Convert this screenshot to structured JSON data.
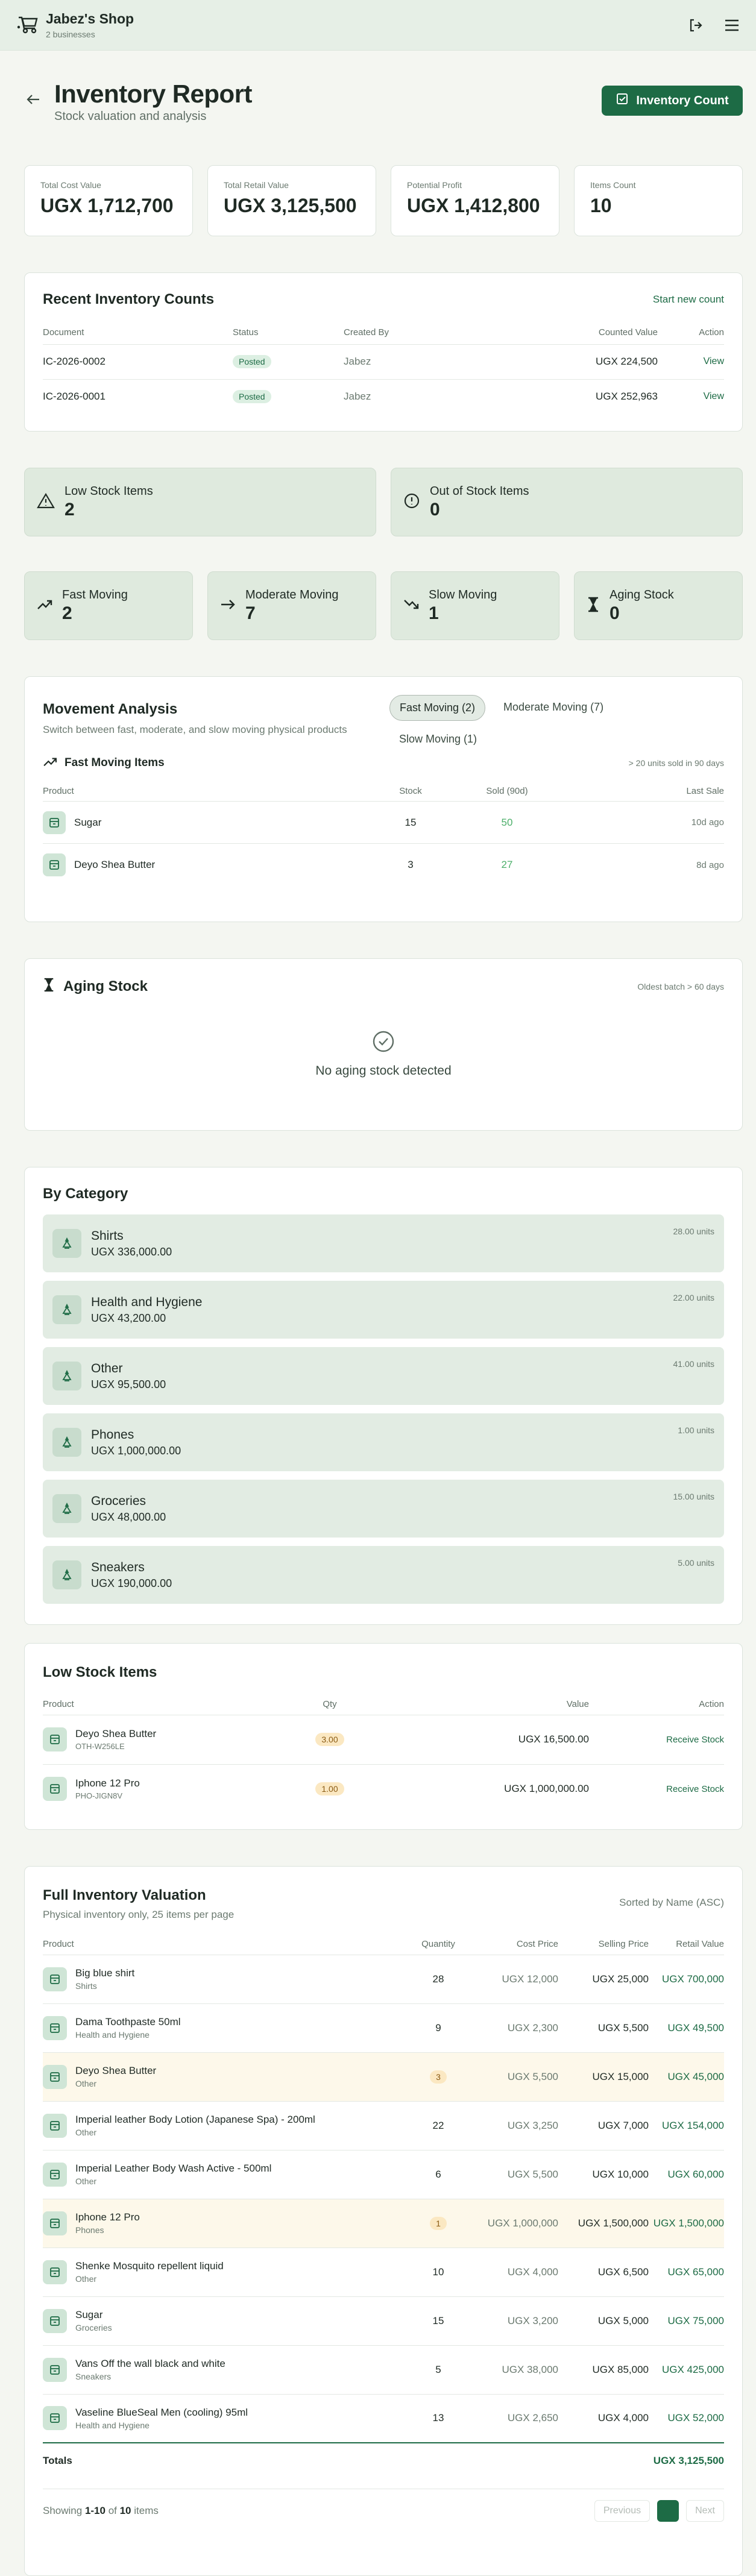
{
  "topbar": {
    "shop_name": "Jabez's Shop",
    "shop_sub": "2 businesses",
    "icons": [
      "store-icon",
      "logout-icon",
      "menu-icon"
    ]
  },
  "header": {
    "title": "Inventory Report",
    "subtitle": "Stock valuation and analysis",
    "count_button": "Inventory Count"
  },
  "stats": [
    {
      "label": "Total Cost Value",
      "value": "UGX 1,712,700"
    },
    {
      "label": "Total Retail Value",
      "value": "UGX 3,125,500"
    },
    {
      "label": "Potential Profit",
      "value": "UGX 1,412,800"
    },
    {
      "label": "Items Count",
      "value": "10"
    }
  ],
  "recent_counts": {
    "title": "Recent Inventory Counts",
    "action": "Start new count",
    "columns": [
      "Document",
      "Status",
      "Created By",
      "Counted Value",
      "Action"
    ],
    "rows": [
      {
        "document": "IC-2026-0002",
        "status": "Posted",
        "created_by": "Jabez",
        "value": "UGX 224,500",
        "action": "View"
      },
      {
        "document": "IC-2026-0001",
        "status": "Posted",
        "created_by": "Jabez",
        "value": "UGX 252,963",
        "action": "View"
      }
    ]
  },
  "alerts": [
    {
      "label": "Low Stock Items",
      "value": "2",
      "icon": "warning-triangle-icon"
    },
    {
      "label": "Out of Stock Items",
      "value": "0",
      "icon": "alert-circle-icon"
    }
  ],
  "movement_cards": [
    {
      "label": "Fast Moving",
      "value": "2",
      "icon": "trending-up-icon"
    },
    {
      "label": "Moderate Moving",
      "value": "7",
      "icon": "arrow-right-icon"
    },
    {
      "label": "Slow Moving",
      "value": "1",
      "icon": "trending-down-icon"
    },
    {
      "label": "Aging Stock",
      "value": "0",
      "icon": "hourglass-icon"
    }
  ],
  "movement": {
    "title": "Movement Analysis",
    "description": "Switch between fast, moderate, and slow moving physical products",
    "tabs": [
      "Fast Moving (2)",
      "Moderate Moving (7)",
      "Slow Moving (1)"
    ],
    "active_tab": 0,
    "sub_title": "Fast Moving Items",
    "sub_note": "> 20 units sold in 90 days",
    "columns": [
      "Product",
      "Stock",
      "Sold (90d)",
      "Last Sale"
    ],
    "rows": [
      {
        "product": "Sugar",
        "stock": "15",
        "sold": "50",
        "last": "10d ago"
      },
      {
        "product": "Deyo Shea Butter",
        "stock": "3",
        "sold": "27",
        "last": "8d ago"
      }
    ]
  },
  "aging": {
    "title": "Aging Stock",
    "note": "Oldest batch > 60 days",
    "empty": "No aging stock detected"
  },
  "by_category": {
    "title": "By Category",
    "items": [
      {
        "name": "Shirts",
        "value": "UGX 336,000.00",
        "units": "28.00 units"
      },
      {
        "name": "Health and Hygiene",
        "value": "UGX 43,200.00",
        "units": "22.00 units"
      },
      {
        "name": "Other",
        "value": "UGX 95,500.00",
        "units": "41.00 units"
      },
      {
        "name": "Phones",
        "value": "UGX 1,000,000.00",
        "units": "1.00 units"
      },
      {
        "name": "Groceries",
        "value": "UGX 48,000.00",
        "units": "15.00 units"
      },
      {
        "name": "Sneakers",
        "value": "UGX 190,000.00",
        "units": "5.00 units"
      }
    ]
  },
  "low_stock": {
    "title": "Low Stock Items",
    "columns": [
      "Product",
      "Qty",
      "Value",
      "Action"
    ],
    "rows": [
      {
        "name": "Deyo Shea Butter",
        "sku": "OTH-W256LE",
        "qty": "3.00",
        "value": "UGX 16,500.00",
        "action": "Receive Stock"
      },
      {
        "name": "Iphone 12 Pro",
        "sku": "PHO-JIGN8V",
        "qty": "1.00",
        "value": "UGX 1,000,000.00",
        "action": "Receive Stock"
      }
    ]
  },
  "valuation": {
    "title": "Full Inventory Valuation",
    "subtitle": "Physical inventory only, 25 items per page",
    "sorted": "Sorted by Name (ASC)",
    "columns": [
      "Product",
      "Quantity",
      "Cost Price",
      "Selling Price",
      "Retail Value"
    ],
    "rows": [
      {
        "name": "Big blue shirt",
        "category": "Shirts",
        "qty": "28",
        "low": false,
        "cost": "UGX 12,000",
        "sell": "UGX 25,000",
        "retail": "UGX 700,000"
      },
      {
        "name": "Dama Toothpaste 50ml",
        "category": "Health and Hygiene",
        "qty": "9",
        "low": false,
        "cost": "UGX 2,300",
        "sell": "UGX 5,500",
        "retail": "UGX 49,500"
      },
      {
        "name": "Deyo Shea Butter",
        "category": "Other",
        "qty": "3",
        "low": true,
        "cost": "UGX 5,500",
        "sell": "UGX 15,000",
        "retail": "UGX 45,000"
      },
      {
        "name": "Imperial leather Body Lotion (Japanese Spa) - 200ml",
        "category": "Other",
        "qty": "22",
        "low": false,
        "cost": "UGX 3,250",
        "sell": "UGX 7,000",
        "retail": "UGX 154,000"
      },
      {
        "name": "Imperial Leather Body Wash Active - 500ml",
        "category": "Other",
        "qty": "6",
        "low": false,
        "cost": "UGX 5,500",
        "sell": "UGX 10,000",
        "retail": "UGX 60,000"
      },
      {
        "name": "Iphone 12 Pro",
        "category": "Phones",
        "qty": "1",
        "low": true,
        "cost": "UGX 1,000,000",
        "sell": "UGX 1,500,000",
        "retail": "UGX 1,500,000"
      },
      {
        "name": "Shenke Mosquito repellent liquid",
        "category": "Other",
        "qty": "10",
        "low": false,
        "cost": "UGX 4,000",
        "sell": "UGX 6,500",
        "retail": "UGX 65,000"
      },
      {
        "name": "Sugar",
        "category": "Groceries",
        "qty": "15",
        "low": false,
        "cost": "UGX 3,200",
        "sell": "UGX 5,000",
        "retail": "UGX 75,000"
      },
      {
        "name": "Vans Off the wall black and white",
        "category": "Sneakers",
        "qty": "5",
        "low": false,
        "cost": "UGX 38,000",
        "sell": "UGX 85,000",
        "retail": "UGX 425,000"
      },
      {
        "name": "Vaseline BlueSeal Men (cooling) 95ml",
        "category": "Health and Hygiene",
        "qty": "13",
        "low": false,
        "cost": "UGX 2,650",
        "sell": "UGX 4,000",
        "retail": "UGX 52,000"
      }
    ],
    "totals_label": "Totals",
    "totals_value": "UGX 3,125,500",
    "pagination": {
      "showing_prefix": "Showing ",
      "range": "1-10",
      "of": " of ",
      "total": "10",
      "suffix": " items",
      "prev": "Previous",
      "next": "Next",
      "page": ""
    }
  },
  "colors": {
    "accent": "#1d6b45",
    "background": "#f4f6f1",
    "tinted_card": "#dfeade",
    "low_row": "#fdf8ea"
  }
}
